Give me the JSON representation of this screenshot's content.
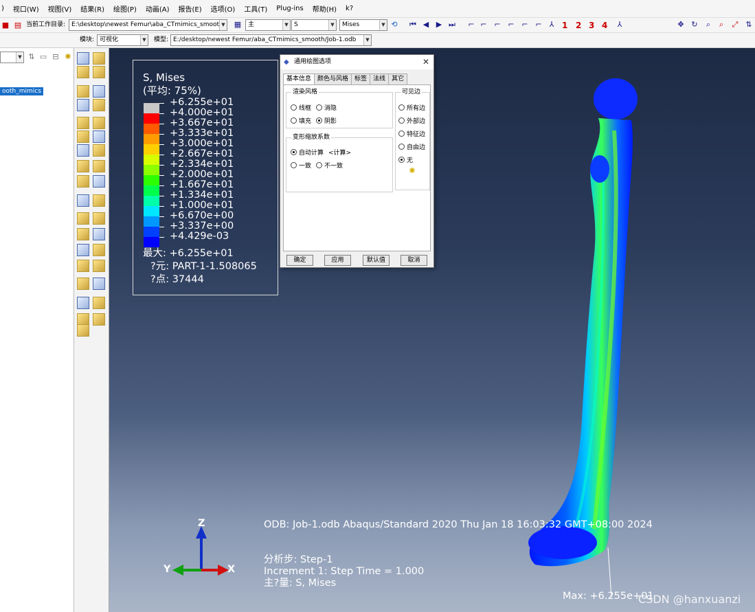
{
  "menubar": {
    "items": [
      ")",
      "视口(W)",
      "视图(V)",
      "结果(R)",
      "绘图(P)",
      "动画(A)",
      "报告(E)",
      "选项(O)",
      "工具(T)",
      "Plug-ins",
      "帮助(H)",
      "k?"
    ]
  },
  "toolbar1": {
    "workdir_label": "当前工作目录:",
    "workdir_value": "E:\\desktop\\newest Femur\\aba_CTmimics_smooth",
    "step_value": "主",
    "field_value": "S",
    "invariant_value": "Mises",
    "view_numbers": [
      "1",
      "2",
      "3",
      "4"
    ]
  },
  "toolbar2": {
    "module_label": "模块:",
    "module_value": "可视化",
    "model_label": "模型:",
    "model_value": "E:/desktop/newest Femur/aba_CTmimics_smooth/Job-1.odb"
  },
  "tree": {
    "selected_item": "ooth_mimics"
  },
  "legend": {
    "title": "S, Mises",
    "average": "(平均: 75%)",
    "values": [
      "+6.255e+01",
      "+4.000e+01",
      "+3.667e+01",
      "+3.333e+01",
      "+3.000e+01",
      "+2.667e+01",
      "+2.334e+01",
      "+2.000e+01",
      "+1.667e+01",
      "+1.334e+01",
      "+1.000e+01",
      "+6.670e+00",
      "+3.337e+00",
      "+4.429e-03"
    ],
    "colors": [
      "#c8c8c8",
      "#ff0000",
      "#ff5a00",
      "#ff9c00",
      "#ffd000",
      "#d8ff00",
      "#8cff00",
      "#2eff00",
      "#00ff4a",
      "#00ffa8",
      "#00e6ff",
      "#0097ff",
      "#0040ff",
      "#0000ff"
    ],
    "max_label": "最大: +6.255e+01",
    "element_label": "?元: PART-1-1.508065",
    "node_label": "?点: 37444"
  },
  "dialog": {
    "title": "通用绘图选项",
    "tabs": [
      "基本信息",
      "颜色与风格",
      "标签",
      "法线",
      "其它"
    ],
    "render_group": "渲染风格",
    "render_options": [
      "线框",
      "消隐",
      "填充",
      "阴影"
    ],
    "visible_edges_group": "可见边",
    "visible_edges": [
      "所有边",
      "外部边",
      "特征边",
      "自由边",
      "无"
    ],
    "deform_group": "变形缩放系数",
    "deform_auto": "自动计算",
    "deform_auto_note": "<计算>",
    "deform_options": [
      "一致",
      "不一致"
    ],
    "buttons": [
      "确定",
      "应用",
      "默认值",
      "取消"
    ]
  },
  "viewport": {
    "odb_line": "ODB: Job-1.odb     Abaqus/Standard 2020     Thu Jan 18 16:03:32 GMT+08:00 2024",
    "step_line": "分析步: Step-1",
    "increment_line": "Increment      1: Step Time =     1.000",
    "primary_var_line": "主?量: S, Mises",
    "max_annotation": "Max: +6.255e+01",
    "triad": {
      "z": "Z",
      "y": "Y",
      "x": "X"
    },
    "watermark": "CSDN @hanxuanzi"
  }
}
